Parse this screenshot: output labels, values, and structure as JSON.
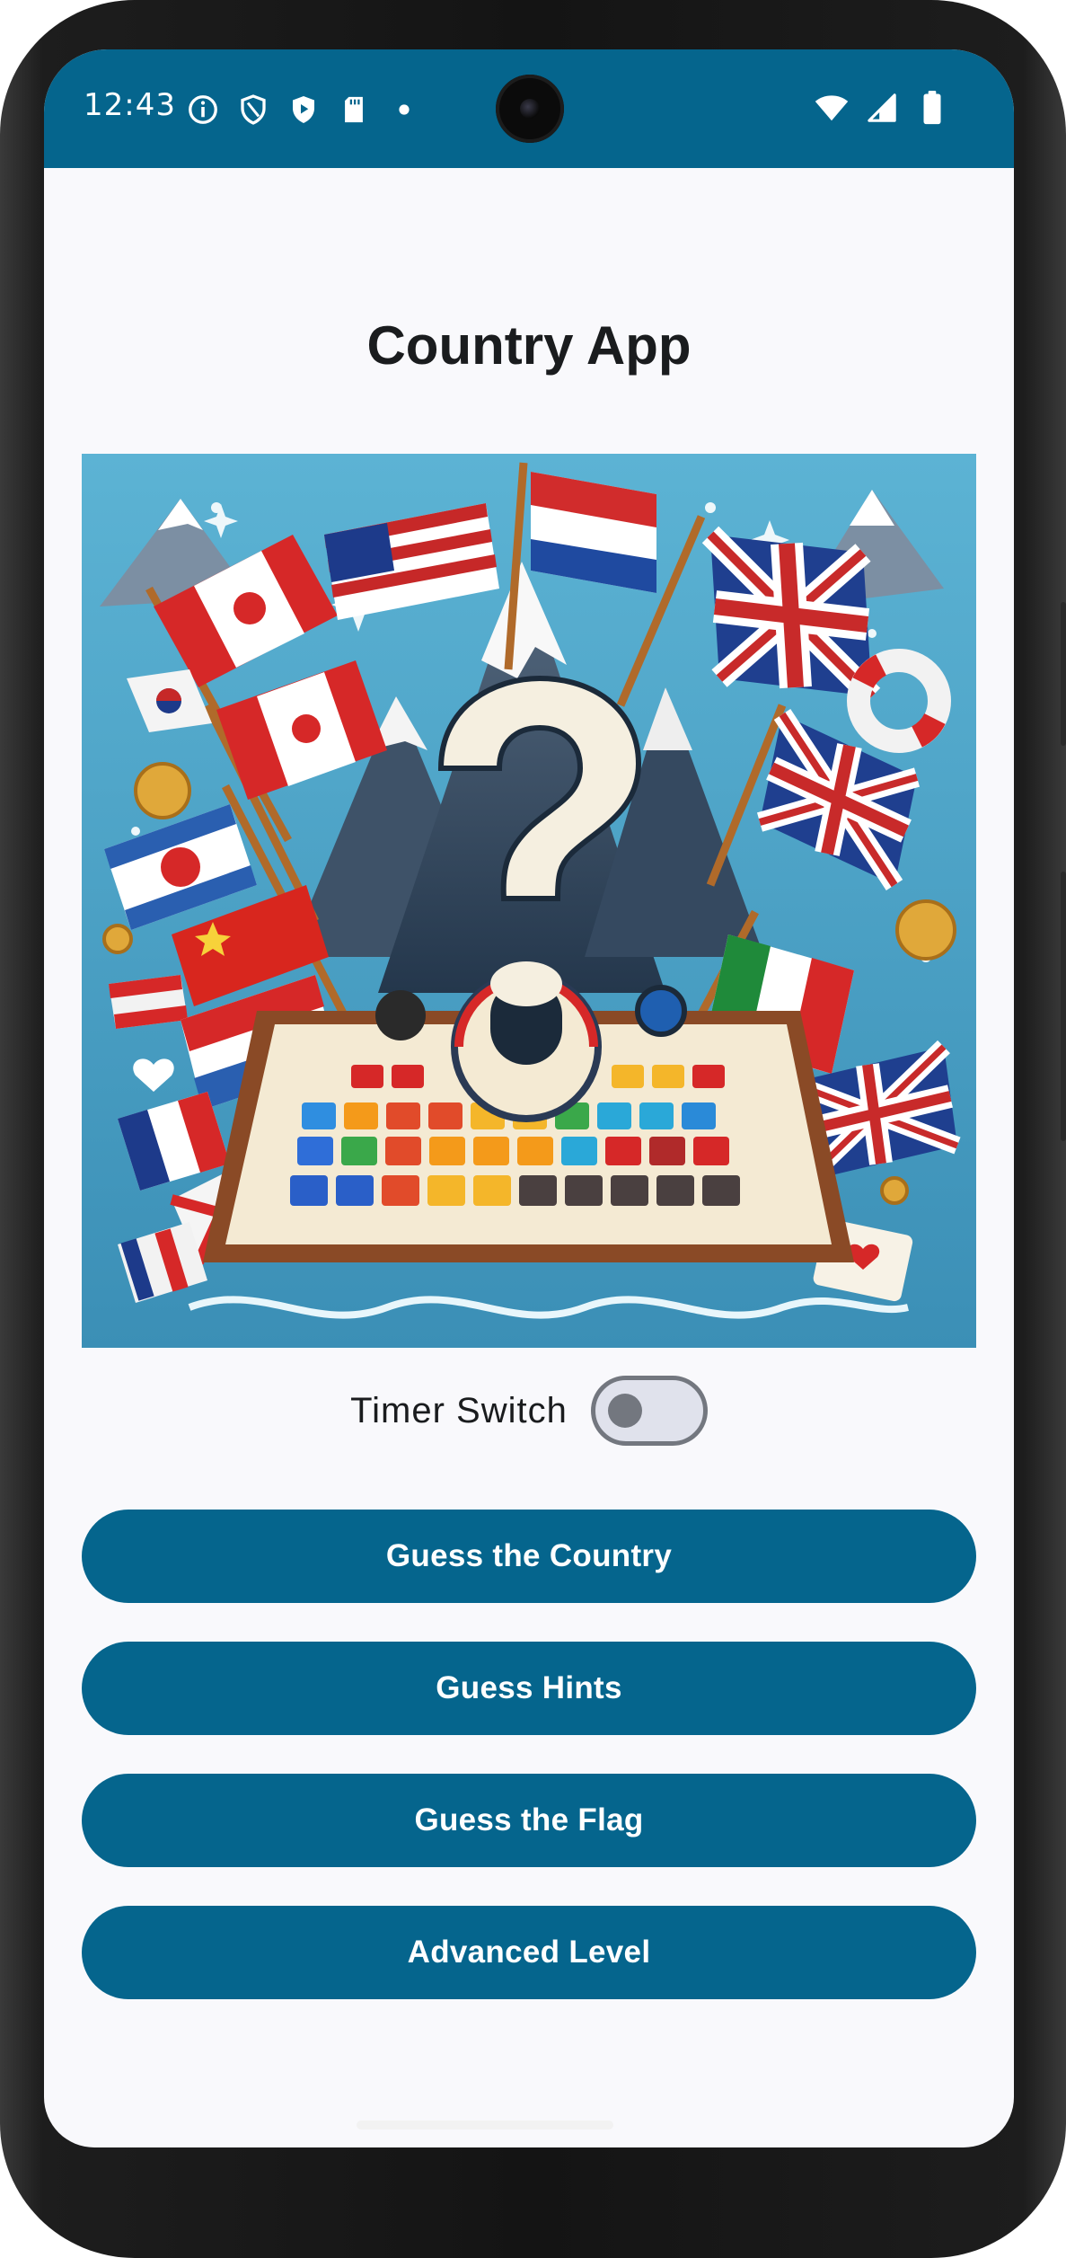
{
  "status_bar": {
    "time": "12:43",
    "left_icons": [
      "info-icon",
      "shield-icon",
      "play-shield-icon",
      "sd-card-icon",
      "dot-icon"
    ],
    "right_icons": [
      "wifi-icon",
      "cell-signal-icon",
      "battery-icon"
    ],
    "background": "#05658d"
  },
  "app": {
    "title": "Country App",
    "hero_image": "flags-mountain-question-illustration",
    "timer": {
      "label": "Timer Switch",
      "enabled": false
    },
    "buttons": [
      {
        "label": "Guess the Country"
      },
      {
        "label": "Guess Hints"
      },
      {
        "label": "Guess the Flag"
      },
      {
        "label": "Advanced Level"
      }
    ]
  },
  "colors": {
    "primary": "#05658d",
    "background": "#f9f9fc",
    "on_surface": "#1a1c1e"
  }
}
